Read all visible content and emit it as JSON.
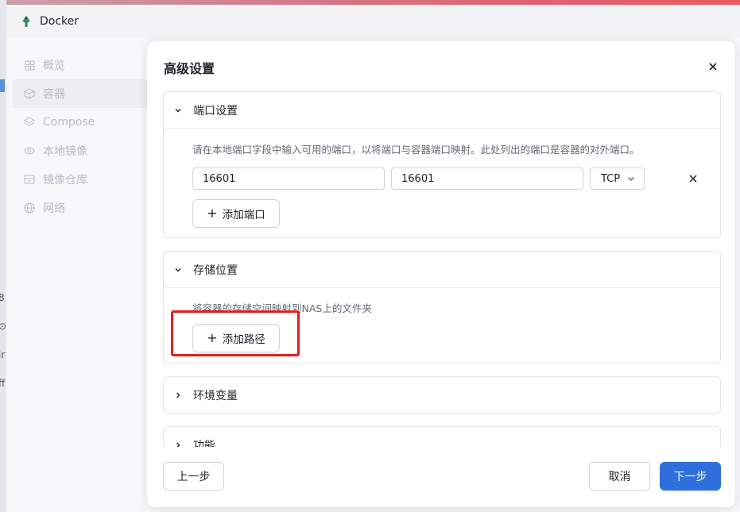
{
  "app": {
    "title": "Docker",
    "accent": "#2f6fdc"
  },
  "left_edge_glyphs": [
    "8",
    "⊙",
    "ir",
    "ff"
  ],
  "sidebar": {
    "items": [
      {
        "label": "概览",
        "icon": "grid-icon"
      },
      {
        "label": "容器",
        "icon": "cube-icon"
      },
      {
        "label": "Compose",
        "icon": "layers-icon"
      },
      {
        "label": "本地镜像",
        "icon": "eye-icon"
      },
      {
        "label": "镜像仓库",
        "icon": "archive-icon"
      },
      {
        "label": "网络",
        "icon": "globe-icon"
      }
    ]
  },
  "dialog": {
    "title": "高级设置",
    "sections": {
      "ports": {
        "title": "端口设置",
        "hint": "请在本地端口字段中输入可用的端口，以将端口与容器端口映射。此处列出的端口是容器的对外端口。",
        "local_port": "16601",
        "container_port": "16601",
        "protocol": "TCP",
        "add_label": "添加端口"
      },
      "storage": {
        "title": "存储位置",
        "hint": "将容器的存储空间映射到NAS上的文件夹",
        "add_label": "添加路径"
      },
      "env": {
        "title": "环境变量"
      },
      "features": {
        "title": "功能"
      }
    },
    "footer": {
      "prev_label": "上一步",
      "cancel_label": "取消",
      "next_label": "下一步"
    }
  }
}
